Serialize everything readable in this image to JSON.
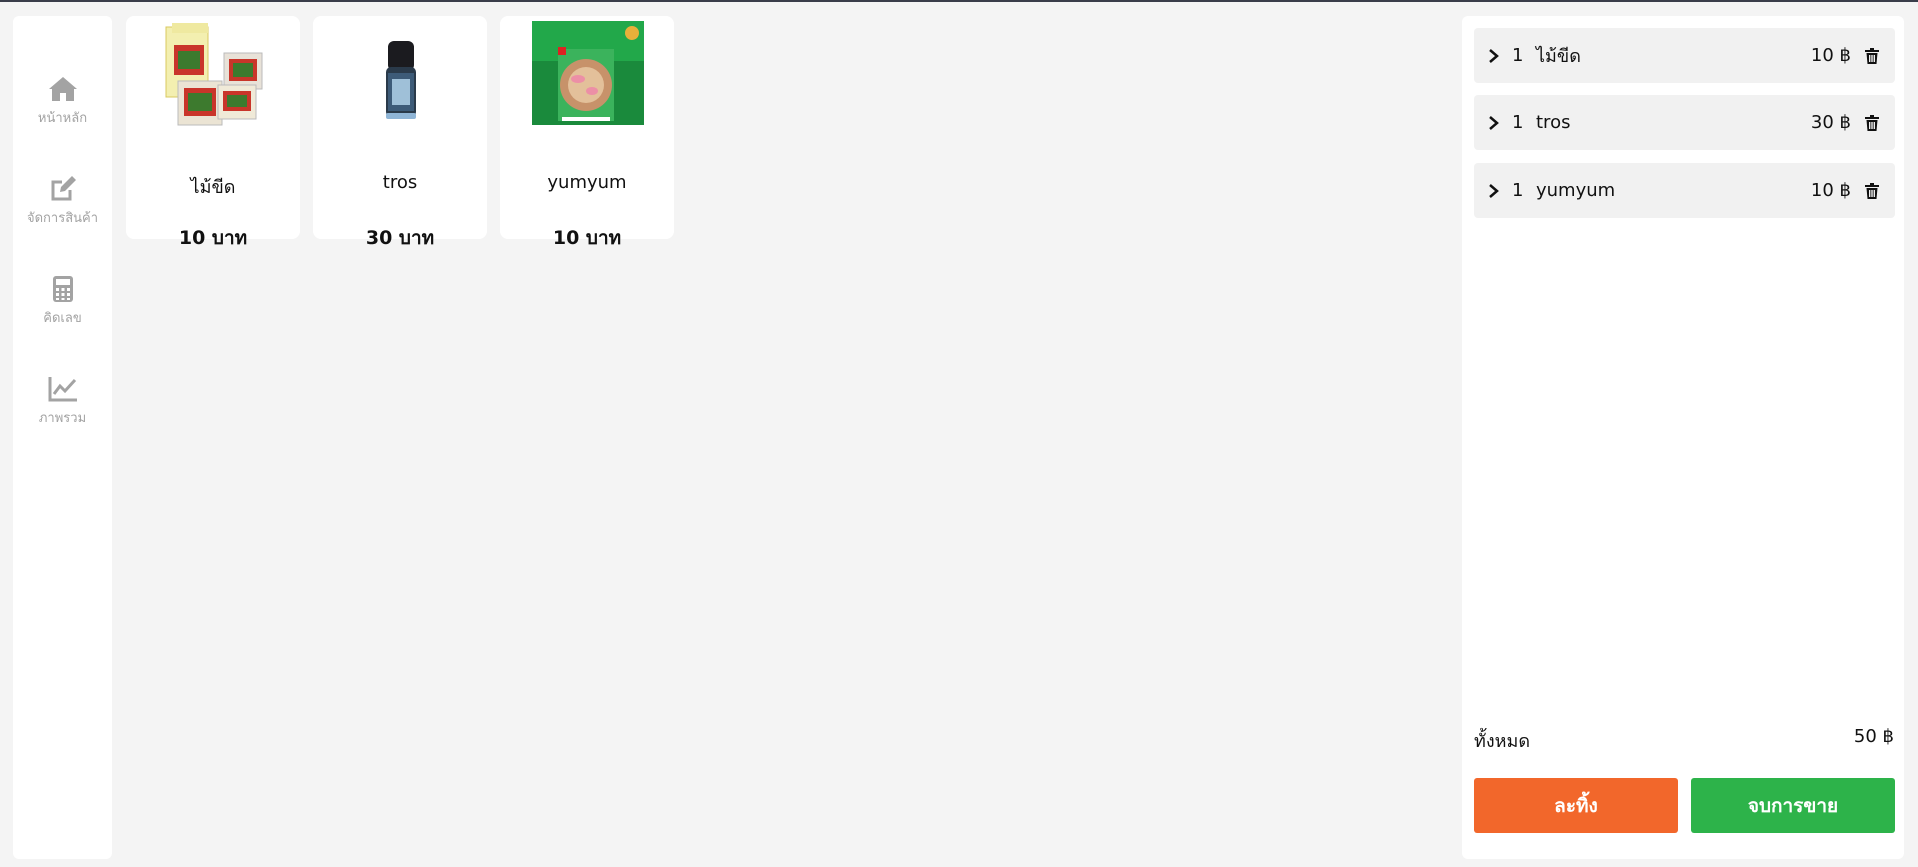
{
  "nav": [
    {
      "icon": "home-icon",
      "label": "หน้าหลัก"
    },
    {
      "icon": "edit-icon",
      "label": "จัดการสินค้า"
    },
    {
      "icon": "calculator-icon",
      "label": "คิดเลข"
    },
    {
      "icon": "chart-line-icon",
      "label": "ภาพรวม"
    }
  ],
  "products": [
    {
      "name": "ไม้ขีด",
      "price": "10 บาท"
    },
    {
      "name": "tros",
      "price": "30 บาท"
    },
    {
      "name": "yumyum",
      "price": "10 บาท"
    }
  ],
  "cart": {
    "items": [
      {
        "qty": "1",
        "name": "ไม้ขีด",
        "price": "10 ฿"
      },
      {
        "qty": "1",
        "name": "tros",
        "price": "30 ฿"
      },
      {
        "qty": "1",
        "name": "yumyum",
        "price": "10 ฿"
      }
    ],
    "total_label": "ทั้งหมด",
    "total_value": "50 ฿",
    "cancel_label": "ละทิ้ง",
    "finish_label": "จบการขาย"
  },
  "colors": {
    "cancel": "#f2672b",
    "finish": "#2db34a",
    "nav_text": "#a3a3a3"
  }
}
